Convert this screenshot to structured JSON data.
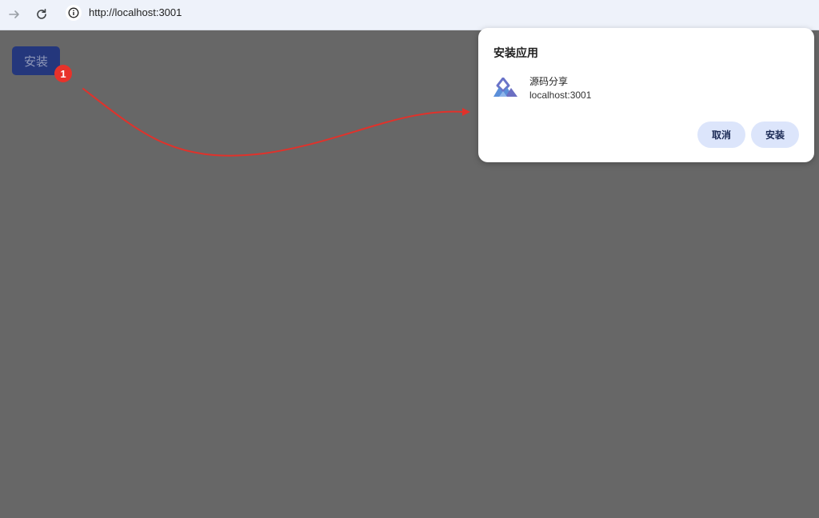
{
  "browser": {
    "url": "http://localhost:3001"
  },
  "page": {
    "install_label": "安装",
    "step_badge": "1"
  },
  "dialog": {
    "title": "安装应用",
    "app_name": "源码分享",
    "app_origin": "localhost:3001",
    "cancel_label": "取消",
    "install_label": "安装"
  },
  "colors": {
    "overlay": "#676767",
    "annotation": "#e8322a",
    "dialog_button_bg": "#dce5fb"
  }
}
